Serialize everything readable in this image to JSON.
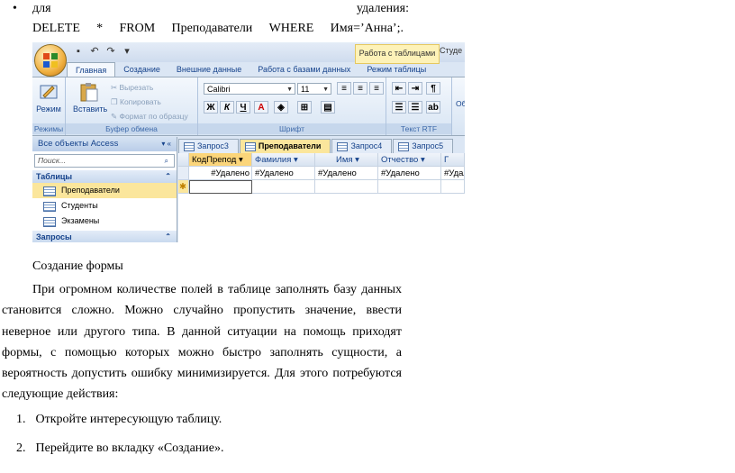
{
  "doc": {
    "bullet": "•",
    "line1_left": "для",
    "line1_right": "удаления:",
    "sql_tokens": [
      "DELETE",
      "*",
      "FROM",
      "Преподаватели",
      "WHERE",
      "Имя=’Анна’;."
    ],
    "heading": "Создание формы",
    "paragraph": "При огромном количестве полей в таблице заполнять базу данных становится сложно. Можно случайно пропустить значение, ввести неверное или другого типа. В данной ситуации на помощь приходят формы, с помощью которых можно быстро заполнять сущности, а вероятность допустить ошибку минимизируется. Для этого потребуются следующие действия:",
    "steps": [
      {
        "num": "1.",
        "text": "Откройте интересующую таблицу."
      },
      {
        "num": "2.",
        "text": "Перейдите во вкладку «Создание»."
      }
    ]
  },
  "app": {
    "context_tab": "Работа с таблицами",
    "context_tab2": "Студе",
    "tabs": [
      "Главная",
      "Создание",
      "Внешние данные",
      "Работа с базами данных",
      "Режим таблицы"
    ],
    "active_tab": "Главная",
    "ribbon": {
      "view_label": "Режим",
      "paste_label": "Вставить",
      "cut_label": "Вырезать",
      "copy_label": "Копировать",
      "format_label": "Формат по образцу",
      "font_name": "Calibri",
      "font_size": "11",
      "groups": [
        "Режимы",
        "Буфер обмена",
        "Шрифт",
        "Текст RTF"
      ],
      "rtf_extra": "Об"
    },
    "nav": {
      "header": "Все объекты Access",
      "search_placeholder": "Поиск...",
      "section_tables": "Таблицы",
      "tables": [
        "Преподаватели",
        "Студенты",
        "Экзамены"
      ],
      "selected_table": "Преподаватели",
      "section_queries": "Запросы"
    },
    "doc_tabs": [
      "Запрос3",
      "Преподаватели",
      "Запрос4",
      "Запрос5"
    ],
    "active_doc_tab": "Преподаватели",
    "grid": {
      "columns": [
        "КодПрепод",
        "Фамилия",
        "Имя",
        "Отчество",
        "Г"
      ],
      "row1": [
        "#Удалено",
        "#Удалено",
        "#Удалено",
        "#Удалено",
        "#Удалено"
      ],
      "new_row_marker": "✱"
    },
    "colors": {
      "accent": "#15428b",
      "selected": "#fbe69c",
      "ribbon": "#dbe6f4"
    }
  }
}
